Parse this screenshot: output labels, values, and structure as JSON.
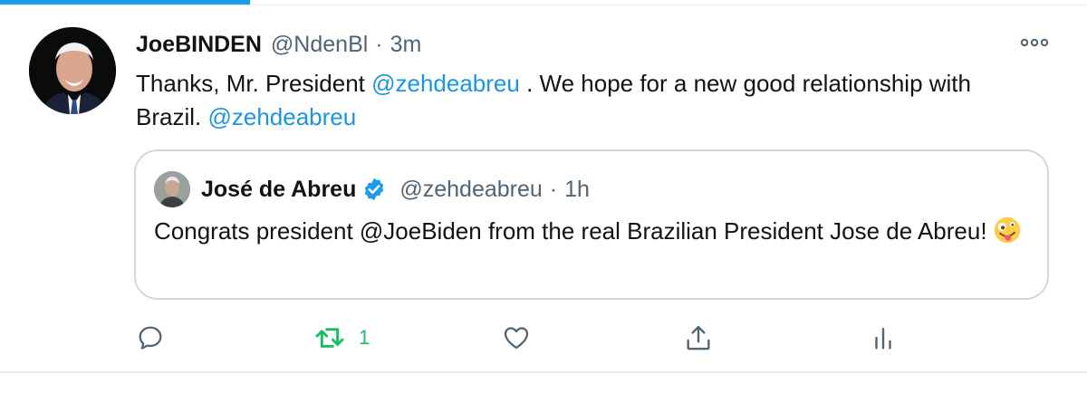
{
  "tweet": {
    "display_name": "JoeBINDEN",
    "handle": "@NdenBl",
    "separator": "·",
    "time": "3m",
    "text_part1": "Thanks, Mr. President ",
    "mention1": "@zehdeabreu",
    "text_part2": " . We hope for a new good relationship with Brazil. ",
    "mention2": "@zehdeabreu",
    "avatar_icon": "profile-photo"
  },
  "quote": {
    "display_name": "José de Abreu",
    "verified_icon": "verified-badge-icon",
    "handle": "@zehdeabreu",
    "separator": "·",
    "time": "1h",
    "text": "Congrats president @JoeBiden from the real Brazilian President Jose de Abreu!",
    "emoji_icon": "zany-face-emoji"
  },
  "actions": {
    "reply_icon": "reply-icon",
    "retweet_icon": "retweet-icon",
    "retweet_count": "1",
    "like_icon": "heart-icon",
    "share_icon": "share-icon",
    "analytics_icon": "analytics-icon"
  },
  "colors": {
    "accent": "#1d9bf0",
    "mention": "#1b95e0",
    "retweet_green": "#17bf63",
    "muted_text": "#536471",
    "border": "#cfd9de"
  }
}
